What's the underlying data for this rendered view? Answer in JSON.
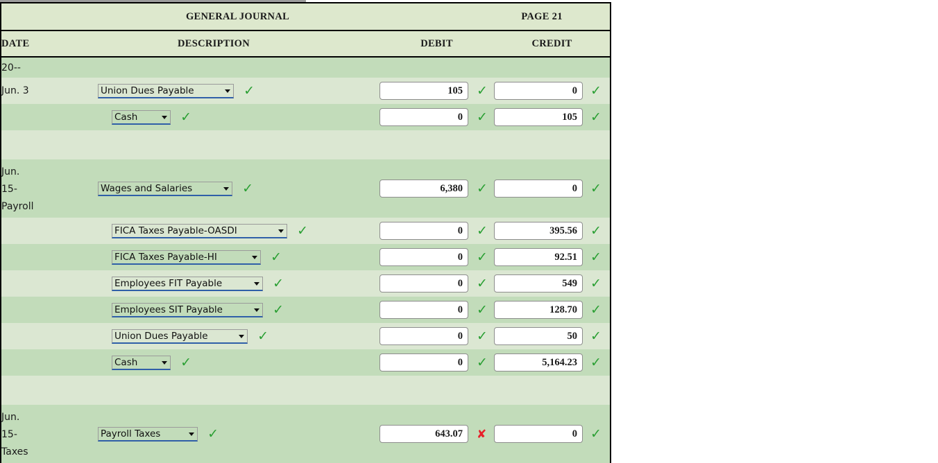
{
  "header": {
    "journal_title": "GENERAL JOURNAL",
    "page_label": "PAGE 21",
    "columns": {
      "date": "DATE",
      "description": "DESCRIPTION",
      "debit": "DEBIT",
      "credit": "CREDIT"
    }
  },
  "year_label": "20--",
  "marks": {
    "ok": "✓",
    "bad": "✘"
  },
  "rows": [
    {
      "date": "Jun. 3",
      "account": "Union Dues Payable",
      "debit": "105",
      "credit": "0",
      "debit_mark": "ok",
      "credit_mark": "ok"
    },
    {
      "date": "",
      "account": "Cash",
      "debit": "0",
      "credit": "105",
      "debit_mark": "ok",
      "credit_mark": "ok"
    },
    {
      "date": "Jun. 15-Payroll",
      "account": "Wages and Salaries",
      "debit": "6,380",
      "credit": "0",
      "debit_mark": "ok",
      "credit_mark": "ok"
    },
    {
      "date": "",
      "account": "FICA Taxes Payable-OASDI",
      "debit": "0",
      "credit": "395.56",
      "debit_mark": "ok",
      "credit_mark": "ok"
    },
    {
      "date": "",
      "account": "FICA Taxes Payable-HI",
      "debit": "0",
      "credit": "92.51",
      "debit_mark": "ok",
      "credit_mark": "ok"
    },
    {
      "date": "",
      "account": "Employees FIT Payable",
      "debit": "0",
      "credit": "549",
      "debit_mark": "ok",
      "credit_mark": "ok"
    },
    {
      "date": "",
      "account": "Employees SIT Payable",
      "debit": "0",
      "credit": "128.70",
      "debit_mark": "ok",
      "credit_mark": "ok"
    },
    {
      "date": "",
      "account": "Union Dues Payable",
      "debit": "0",
      "credit": "50",
      "debit_mark": "ok",
      "credit_mark": "ok"
    },
    {
      "date": "",
      "account": "Cash",
      "debit": "0",
      "credit": "5,164.23",
      "debit_mark": "ok",
      "credit_mark": "ok"
    },
    {
      "date": "Jun. 15-Taxes",
      "account": "Payroll Taxes",
      "debit": "643.07",
      "credit": "0",
      "debit_mark": "bad",
      "credit_mark": "ok"
    }
  ],
  "date_lines": {
    "payroll": [
      "Jun.",
      "15-",
      "Payroll"
    ],
    "taxes": [
      "Jun.",
      "15-",
      "Taxes"
    ]
  },
  "colors": {
    "header_bg": "#dde8cd",
    "stripe_dark": "#c2dcba",
    "stripe_light": "#dbe7d2",
    "check_green": "#2a9f33",
    "cross_red": "#e8202a",
    "select_underline": "#2f5fa8"
  }
}
